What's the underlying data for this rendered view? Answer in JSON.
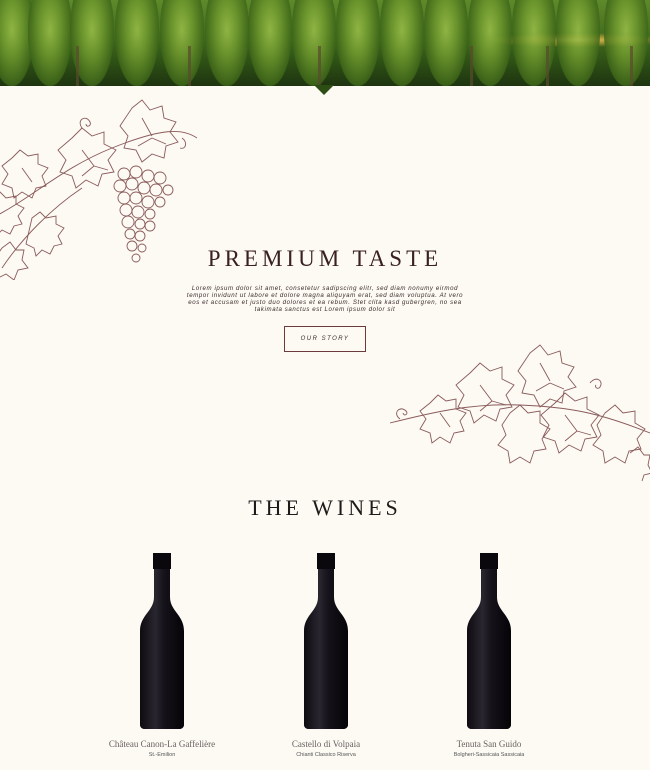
{
  "hero": {
    "image_alt": "Vineyard"
  },
  "intro": {
    "title": "PREMIUM TASTE",
    "body": "Lorem ipsum dolor sit amet, consetetur sadipscing elitr, sed diam nonumy eirmod tempor invidunt ut labore et dolore magna aliquyam erat, sed diam voluptua. At vero eos et accusam et justo duo dolores et ea rebum. Stet clita kasd gubergren, no sea takimata sanctus est Lorem ipsum dolor sit",
    "button_label": "OUR STORY"
  },
  "wines": {
    "title": "THE WINES",
    "items": [
      {
        "name": "Château Canon-La Gaffelière",
        "region": "St.-Emilion"
      },
      {
        "name": "Castello di Volpaia",
        "region": "Chianti Classico Riserva"
      },
      {
        "name": "Tenuta San Guido",
        "region": "Bolgheri-Sassicaia Sassicaia"
      }
    ]
  },
  "colors": {
    "background": "#fcfaf3",
    "accent": "#6b3b3b",
    "illustration": "#8a5a5a"
  }
}
